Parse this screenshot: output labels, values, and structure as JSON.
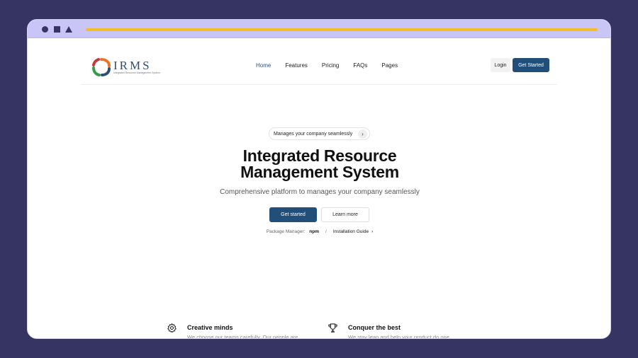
{
  "brand": {
    "name": "IRMS",
    "tagline": "Integrated Resource Management System",
    "colors": {
      "orange": "#e8742a",
      "green": "#3a9a4a",
      "blue": "#2b4e74",
      "red": "#c43b3b"
    }
  },
  "nav": {
    "links": [
      "Home",
      "Features",
      "Pricing",
      "FAQs",
      "Pages"
    ],
    "active": "Home",
    "login_label": "Login",
    "get_started_label": "Get Started"
  },
  "hero": {
    "badge_text": "Manages your company seamlessly",
    "badge_icon": "chevron-right-icon",
    "title_line1": "Integrated Resource",
    "title_line2": "Management System",
    "subtitle": "Comprehensive platform to manages your company seamlessly",
    "primary_button": "Get started",
    "secondary_button": "Learn more",
    "package_manager_label": "Package Manager:",
    "package_manager_value": "npm",
    "separator": "/",
    "installation_link": "Installation Guide"
  },
  "features": [
    {
      "icon": "gear-icon",
      "title": "Creative minds",
      "desc": "We choose our teams carefully. Our people are"
    },
    {
      "icon": "trophy-icon",
      "title": "Conquer the best",
      "desc": "We stay lean and help your product do one"
    }
  ],
  "theme": {
    "accent": "#224f7a",
    "background": "#363463",
    "chrome": "#c9c5f7",
    "progress": "#f4be2a"
  }
}
